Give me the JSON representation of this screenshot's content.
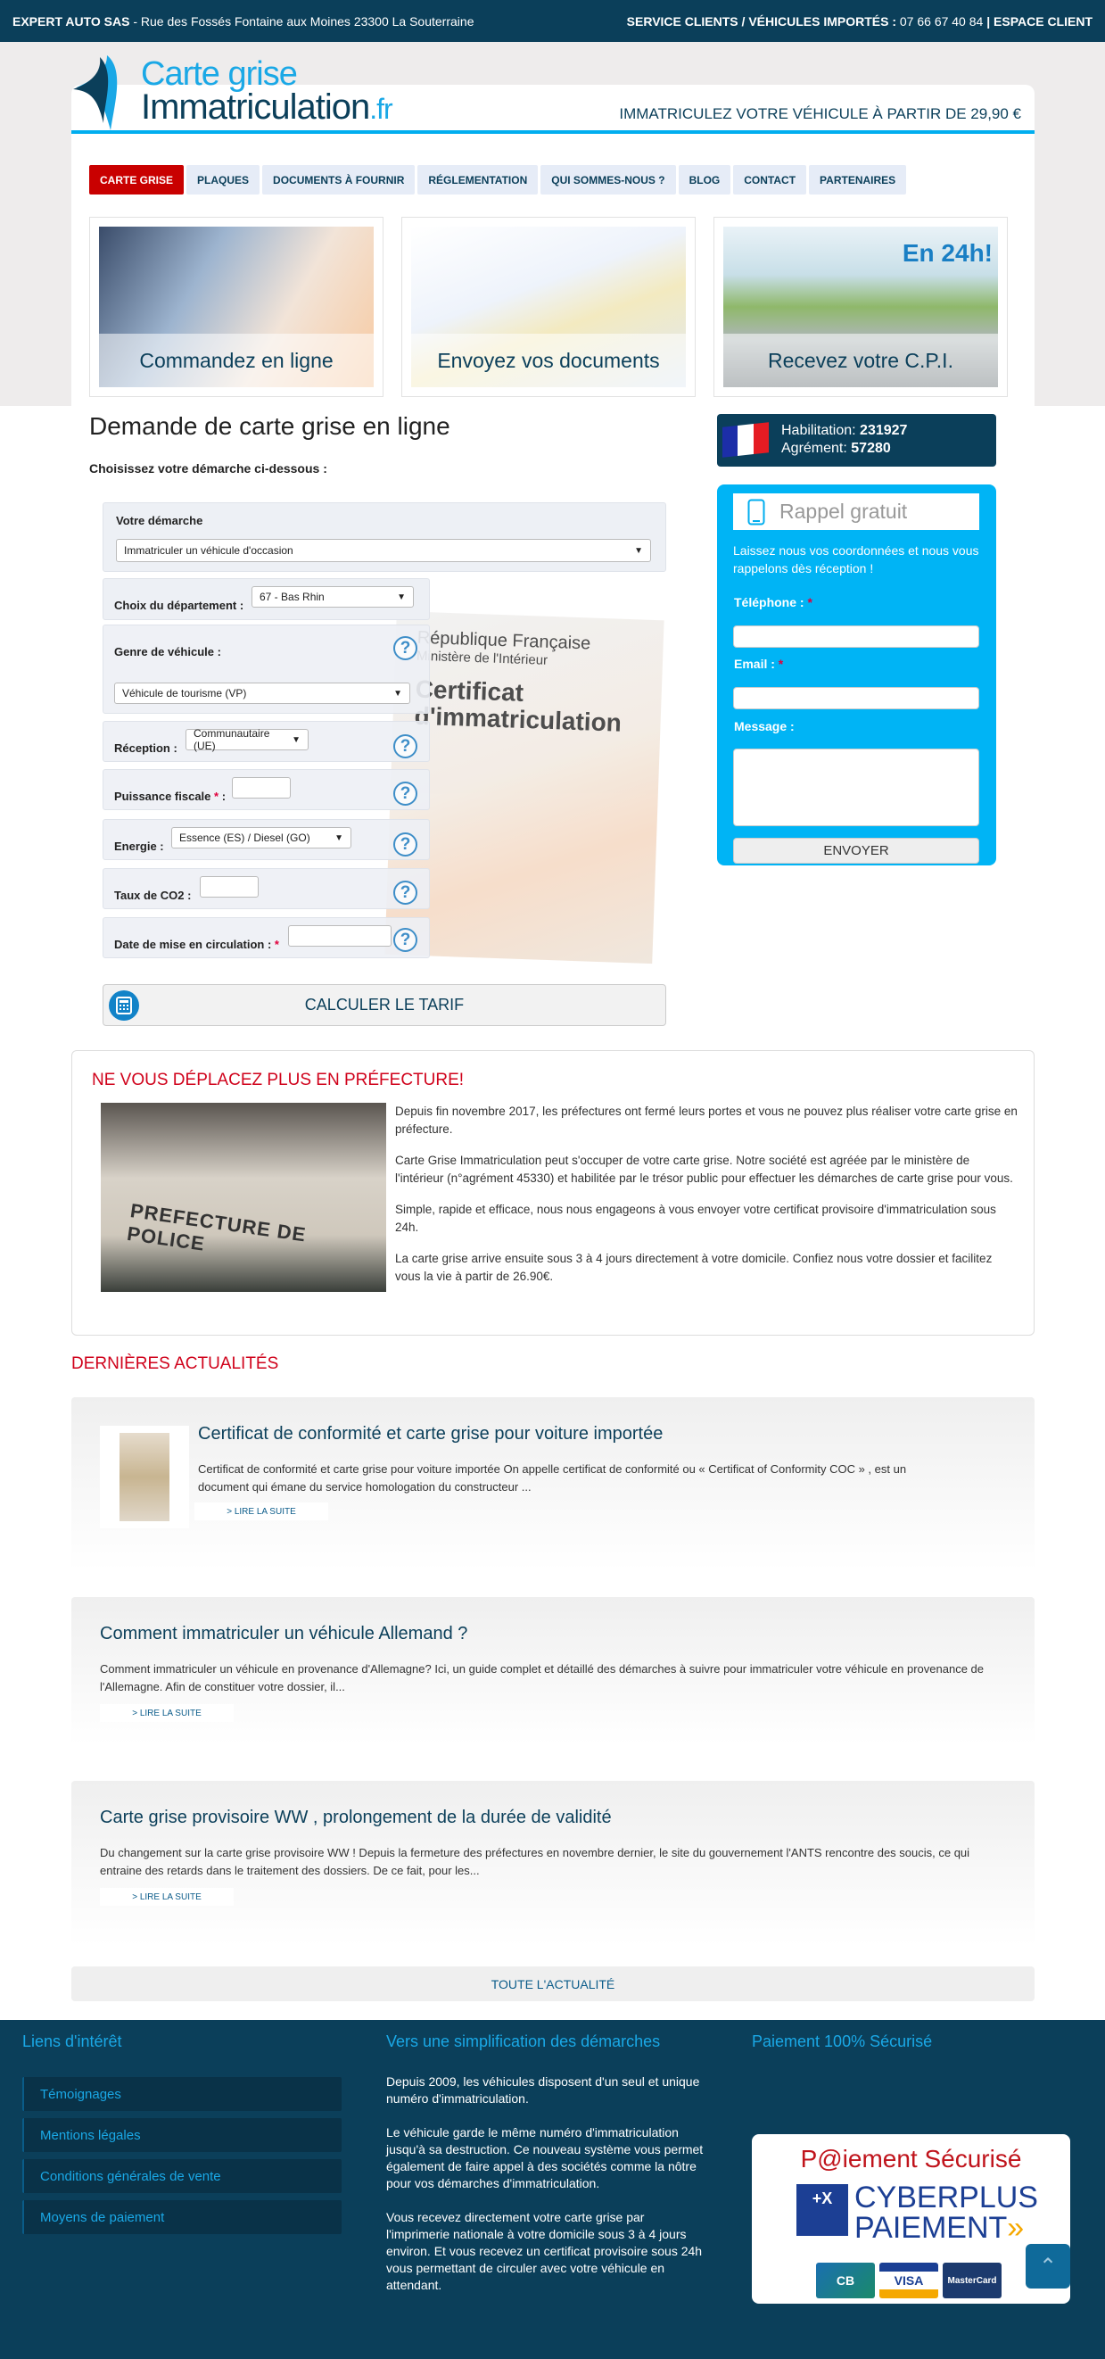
{
  "topbar": {
    "company": "EXPERT AUTO SAS",
    "address": " - Rue des Fossés Fontaine aux Moines 23300 La Souterraine",
    "service": "SERVICE CLIENTS / VÉHICULES IMPORTÉS :",
    "phone": " 07 66 67 40 84 ",
    "sep": "|",
    "espace_client": " ESPACE CLIENT"
  },
  "header": {
    "logo_line1": "Carte grise",
    "logo_line2": "Immatriculation",
    "logo_tld": ".fr",
    "slogan": "IMMATRICULEZ VOTRE VÉHICULE À PARTIR DE 29,90 €"
  },
  "nav": [
    {
      "label": "CARTE GRISE",
      "active": true
    },
    {
      "label": "PLAQUES"
    },
    {
      "label": "DOCUMENTS À FOURNIR"
    },
    {
      "label": "RÉGLEMENTATION"
    },
    {
      "label": "QUI SOMMES-NOUS ?"
    },
    {
      "label": "BLOG"
    },
    {
      "label": "CONTACT"
    },
    {
      "label": "PARTENAIRES"
    }
  ],
  "features": [
    {
      "caption": "Commandez en ligne"
    },
    {
      "caption": "Envoyez vos documents"
    },
    {
      "caption": "Recevez votre C.P.I.",
      "badge": "En 24h!"
    }
  ],
  "form": {
    "title": "Demande de carte grise en ligne",
    "subtitle": "Choisissez votre démarche ci-dessous :",
    "demarche_label": "Votre démarche",
    "demarche_value": "Immatriculer un véhicule d'occasion",
    "departement_label": "Choix du département :",
    "departement_value": "67 - Bas Rhin",
    "genre_label": "Genre de véhicule :",
    "genre_value": "Véhicule de tourisme (VP)",
    "reception_label": "Réception :",
    "reception_value": "Communautaire (UE)",
    "puissance_label": "Puissance fiscale ",
    "puissance_suffix": " :",
    "energie_label": "Energie :",
    "energie_value": "Essence (ES) / Diesel (GO)",
    "co2_label": "Taux de CO2 :",
    "date_label": "Date de mise en circulation : ",
    "required_mark": "*",
    "help_glyph": "?",
    "calc_button": "CALCULER LE TARIF",
    "cert_republique": "République Française",
    "cert_ministere": "Ministère de l'Intérieur",
    "cert_title": "Certificat d'immatriculation"
  },
  "habilitation": {
    "hab_label": "Habilitation: ",
    "hab_value": "231927",
    "agr_label": "Agrément: ",
    "agr_value": "57280"
  },
  "rappel": {
    "title": "Rappel gratuit",
    "description": "Laissez nous vos coordonnées et nous vous rappelons dès réception !",
    "telephone_label": "Téléphone : ",
    "email_label": "Email : ",
    "message_label": "Message :",
    "required_mark": "*",
    "submit": "ENVOYER"
  },
  "prefecture": {
    "title": "NE VOUS DÉPLACEZ PLUS EN PRÉFECTURE!",
    "image_sign": "PREFECTURE DE POLICE",
    "paragraphs": [
      "Depuis fin novembre 2017, les préfectures ont fermé leurs portes et vous ne pouvez plus réaliser votre carte grise en préfecture.",
      "Carte Grise Immatriculation  peut s'occuper de votre carte grise. Notre société est agréée par le ministère de l'intérieur (n°agrément 45330) et habilitée par le trésor public pour effectuer les démarches de carte grise pour vous.",
      "Simple, rapide et efficace, nous nous engageons à vous envoyer votre certificat provisoire d'immatriculation sous 24h.",
      "La carte grise arrive ensuite sous 3 à 4 jours directement à votre domicile. Confiez nous votre dossier et facilitez vous la vie à partir de 26.90€."
    ]
  },
  "news": {
    "heading": "DERNIÈRES ACTUALITÉS",
    "items": [
      {
        "title": "Certificat de conformité et carte grise pour voiture importée",
        "excerpt": "Certificat de conformité et carte grise pour voiture importée   On appelle  certificat de conformité ou « Certificat of Conformity  COC » , est un document qui émane du service homologation du constructeur ...",
        "more": "> LIRE LA SUITE"
      },
      {
        "title": "Comment immatriculer un véhicule Allemand ?",
        "excerpt": "Comment immatriculer un véhicule en provenance d'Allemagne?  Ici, un guide complet et détaillé des démarches  à suivre  pour immatriculer votre véhicule en provenance de l'Allemagne.  Afin de constituer votre dossier, il...",
        "more": "> LIRE LA SUITE"
      },
      {
        "title": "Carte grise provisoire WW , prolongement de la durée de validité",
        "excerpt": "Du changement sur la carte grise provisoire WW ! Depuis la fermeture des préfectures en novembre dernier, le site du gouvernement l'ANTS rencontre des soucis, ce qui entraine des retards dans le traitement des dossiers. De ce fait, pour les...",
        "more": "> LIRE LA SUITE"
      }
    ],
    "all": "TOUTE L'ACTUALITÉ"
  },
  "footer": {
    "links_title": "Liens d'intérêt",
    "links": [
      "Témoignages",
      "Mentions légales",
      "Conditions générales de vente",
      "Moyens de paiement"
    ],
    "simpl_title": "Vers une simplification des démarches",
    "simpl_paragraphs": [
      "Depuis 2009, les véhicules disposent d'un seul et unique numéro d'immatriculation.",
      "Le véhicule garde le même numéro d'immatriculation jusqu'à sa destruction. Ce nouveau système vous permet également de faire appel à des sociétés comme la nôtre pour vos démarches d'immatriculation.",
      "Vous recevez directement votre carte grise par l'imprimerie nationale à votre domicile sous 3 à 4 jours environ. Et vous recevez un certificat provisoire sous 24h vous permettant de circuler avec votre véhicule en attendant."
    ],
    "pay_title": "Paiement 100% Sécurisé",
    "pay_logo_title": "P@iement Sécurisé",
    "pay_bank": "+X",
    "pay_brand1": "CYBERPLUS",
    "pay_brand2": "PAIEMENT",
    "pay_chevrons": "»",
    "cards": [
      "CB",
      "VISA",
      "MasterCard"
    ]
  },
  "colors": {
    "topbar": "#0b3f5a",
    "accent": "#00aeef",
    "red": "#c90000",
    "rappel": "#00b4f5"
  }
}
